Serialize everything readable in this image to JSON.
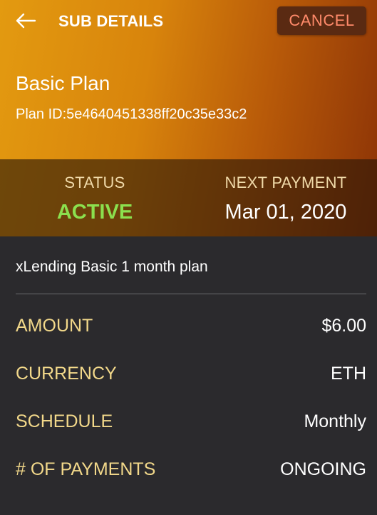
{
  "header": {
    "title": "SUB DETAILS",
    "cancel_label": "CANCEL",
    "back_icon": "arrow-left-icon"
  },
  "plan": {
    "name": "Basic Plan",
    "id_line": "Plan ID:5e4640451338ff20c35e33c2"
  },
  "status": {
    "label": "STATUS",
    "value": "ACTIVE"
  },
  "next_payment": {
    "label": "NEXT PAYMENT",
    "value": "Mar 01, 2020"
  },
  "description": "xLending Basic 1 month plan",
  "details": [
    {
      "label": "AMOUNT",
      "value": "$6.00"
    },
    {
      "label": "CURRENCY",
      "value": "ETH"
    },
    {
      "label": "SCHEDULE",
      "value": "Monthly"
    },
    {
      "label": "# OF PAYMENTS",
      "value": "ONGOING"
    }
  ],
  "colors": {
    "hero_start": "#e39a10",
    "hero_end": "#8c3306",
    "active_status": "#8be04e",
    "label_gold": "#f2d88a",
    "cancel_text": "#ff8a6a",
    "background": "#2b2a2d"
  }
}
